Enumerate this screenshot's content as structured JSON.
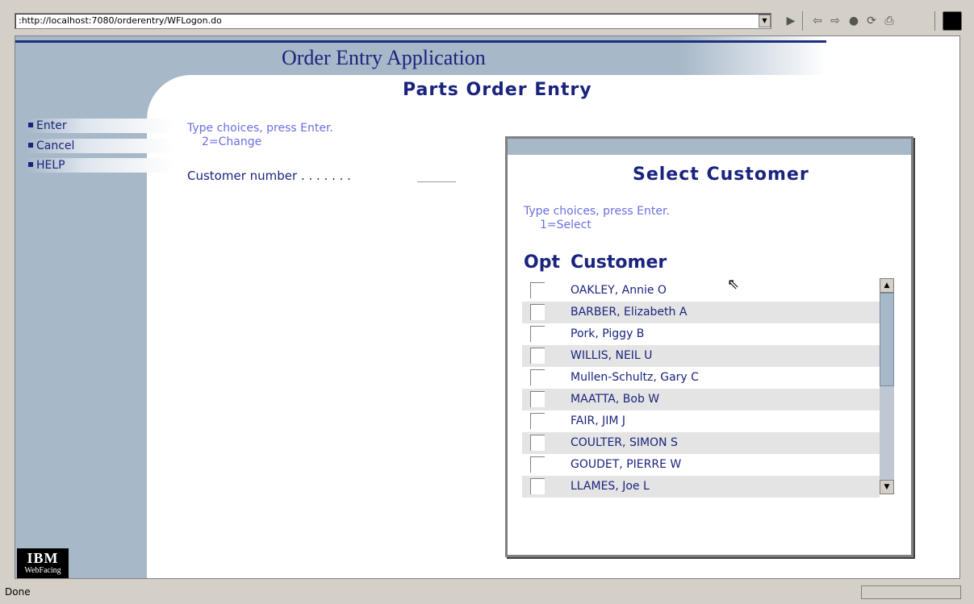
{
  "browser": {
    "url": ":http://localhost:7080/orderentry/WFLogon.do",
    "status": "Done"
  },
  "app": {
    "title": "Order Entry Application",
    "page_title": "Parts Order Entry",
    "logo_top": "IBM",
    "logo_bottom": "WebFacing"
  },
  "menu": [
    {
      "label": "Enter"
    },
    {
      "label": "Cancel"
    },
    {
      "label": "HELP"
    }
  ],
  "main": {
    "instruction": "Type choices, press Enter.",
    "option": "2=Change",
    "customer_label": "Customer number . . . . . . ."
  },
  "dialog": {
    "title": "Select Customer",
    "instruction": "Type choices, press Enter.",
    "option": "1=Select",
    "col_opt": "Opt",
    "col_customer": "Customer",
    "rows": [
      {
        "name": "OAKLEY, Annie O"
      },
      {
        "name": "BARBER, Elizabeth A"
      },
      {
        "name": "Pork, Piggy B"
      },
      {
        "name": "WILLIS, NEIL U"
      },
      {
        "name": "Mullen-Schultz, Gary C"
      },
      {
        "name": "MAATTA, Bob W"
      },
      {
        "name": "FAIR, JIM J"
      },
      {
        "name": "COULTER, SIMON S"
      },
      {
        "name": "GOUDET, PIERRE W"
      },
      {
        "name": "LLAMES, Joe L"
      }
    ]
  },
  "icons": {
    "go": "play-icon",
    "back": "back-arrow-icon",
    "forward": "forward-arrow-icon",
    "stop": "stop-icon",
    "refresh": "refresh-icon",
    "print": "print-icon"
  }
}
